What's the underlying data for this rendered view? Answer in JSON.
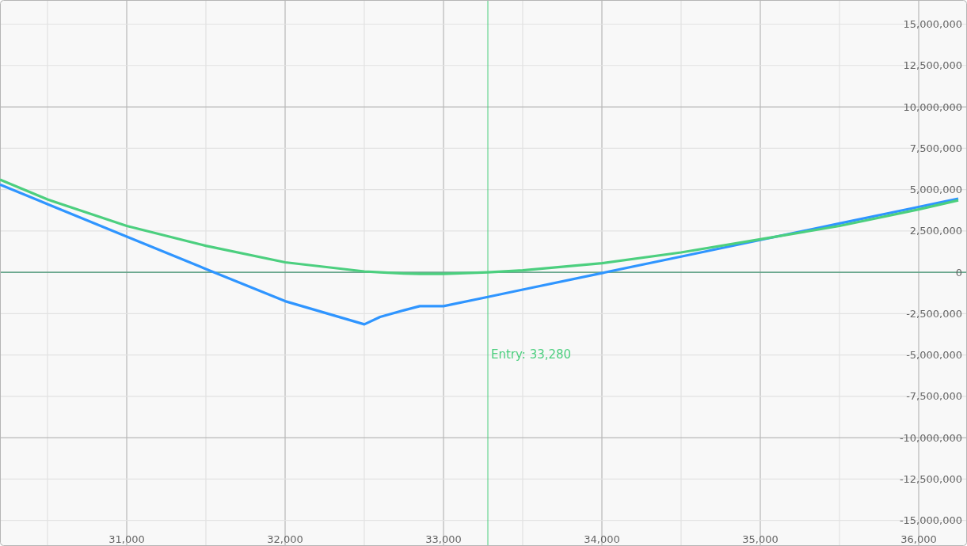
{
  "chart": {
    "chart_data": {
      "type": "line",
      "x": [
        30200,
        30500,
        31000,
        31500,
        32000,
        32500,
        32600,
        32750,
        32850,
        33000,
        33280,
        33500,
        34000,
        34500,
        35000,
        35500,
        36000,
        36250
      ],
      "series": [
        {
          "color": "#2f95ff",
          "values": [
            5300000,
            4120000,
            2160000,
            200000,
            -1750000,
            -3150000,
            -2700000,
            -2300000,
            -2050000,
            -2050000,
            -1490000,
            -1050000,
            -50000,
            950000,
            1950000,
            2950000,
            3950000,
            4450000
          ]
        },
        {
          "color": "#4ccf7f",
          "values": [
            5600000,
            4400000,
            2800000,
            1600000,
            600000,
            50000,
            0,
            -80000,
            -100000,
            -100000,
            0,
            120000,
            550000,
            1200000,
            2000000,
            2800000,
            3800000,
            4350000
          ]
        }
      ],
      "xlim": [
        30200,
        36305
      ],
      "ylim": [
        -16550000,
        16460000
      ],
      "xticks": [
        {
          "value": 31000,
          "label": "31,000"
        },
        {
          "value": 32000,
          "label": "32,000"
        },
        {
          "value": 33000,
          "label": "33,000"
        },
        {
          "value": 34000,
          "label": "34,000"
        },
        {
          "value": 35000,
          "label": "35,000"
        },
        {
          "value": 36000,
          "label": "36,000"
        }
      ],
      "yticks": [
        {
          "value": 15000000,
          "label": "15,000,000"
        },
        {
          "value": 12500000,
          "label": "12,500,000"
        },
        {
          "value": 10000000,
          "label": "10,000,000"
        },
        {
          "value": 7500000,
          "label": "7,500,000"
        },
        {
          "value": 5000000,
          "label": "5,000,000"
        },
        {
          "value": 2500000,
          "label": "2,500,000"
        },
        {
          "value": 0,
          "label": "0"
        },
        {
          "value": -2500000,
          "label": "-2,500,000"
        },
        {
          "value": -5000000,
          "label": "-5,000,000"
        },
        {
          "value": -7500000,
          "label": "-7,500,000"
        },
        {
          "value": -10000000,
          "label": "-10,000,000"
        },
        {
          "value": -12500000,
          "label": "-12,500,000"
        },
        {
          "value": -15000000,
          "label": "-15,000,000"
        }
      ],
      "grid": true,
      "ref_lines": [
        {
          "axis": "y",
          "value": 0
        },
        {
          "axis": "x",
          "value": 33280,
          "label": "Entry: 33,280"
        }
      ]
    }
  }
}
